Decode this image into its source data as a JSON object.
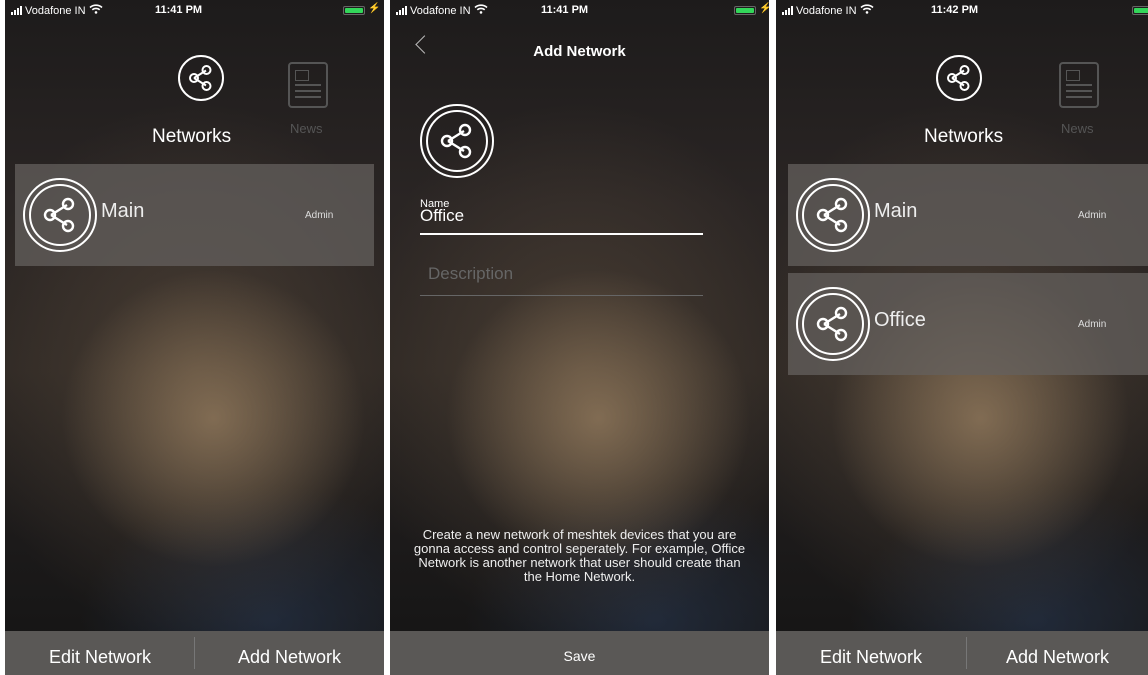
{
  "status_bar": [
    {
      "carrier": "Vodafone IN",
      "time": "11:41 PM"
    },
    {
      "carrier": "Vodafone IN",
      "time": "11:41 PM"
    },
    {
      "carrier": "Vodafone IN",
      "time": "11:42 PM"
    }
  ],
  "networks_screen_1": {
    "tabs": {
      "networks": "Networks",
      "news": "News"
    },
    "networks": [
      {
        "name": "Main",
        "role": "Admin"
      }
    ],
    "buttons": {
      "edit": "Edit Network",
      "add": "Add Network"
    }
  },
  "add_network_screen": {
    "title": "Add Network",
    "name_label": "Name",
    "name_value": "Office",
    "description_placeholder": "Description",
    "hint": "Create a new network of meshtek devices that you are gonna access and control seperately. For example, Office Network is another network that user should create than the Home Network.",
    "save": "Save"
  },
  "networks_screen_2": {
    "tabs": {
      "networks": "Networks",
      "news": "News"
    },
    "networks": [
      {
        "name": "Main",
        "role": "Admin"
      },
      {
        "name": "Office",
        "role": "Admin"
      }
    ],
    "buttons": {
      "edit": "Edit Network",
      "add": "Add Network"
    }
  },
  "colors": {
    "battery": "#33d65a",
    "row_bg": "#64605d",
    "bottom_bar": "#5a5856",
    "muted": "#555555"
  }
}
